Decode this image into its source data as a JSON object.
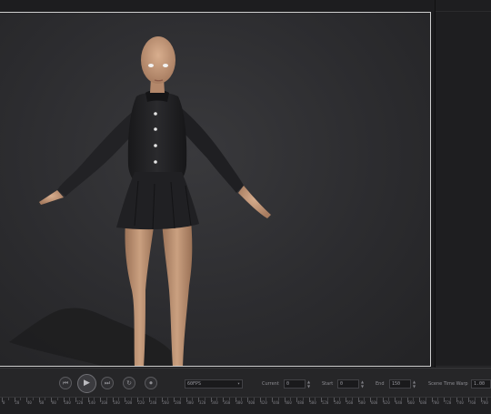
{
  "viewport": {
    "label": "3D viewport"
  },
  "transport": {
    "buttons": [
      {
        "name": "skip-to-start-button",
        "glyph": "⏮"
      },
      {
        "name": "play-button",
        "glyph": "▶"
      },
      {
        "name": "skip-to-end-button",
        "glyph": "⏭"
      },
      {
        "name": "loop-button",
        "glyph": "↻"
      },
      {
        "name": "record-button",
        "glyph": "⏺"
      }
    ],
    "fps_dropdown": "60FPS",
    "current_label": "Current",
    "current_value": "0",
    "start_label": "Start",
    "start_value": "0",
    "end_label": "End",
    "end_value": "150",
    "time_warp_label": "Scene Time Warp",
    "time_warp_value": "1.00",
    "spin_up": "▲",
    "spin_down": "▼",
    "dropdown_arrow": "▾"
  },
  "ruler": {
    "labels": [
      "0",
      "20",
      "40",
      "60",
      "80",
      "100",
      "120",
      "140",
      "160",
      "180",
      "200",
      "220",
      "240",
      "260",
      "280",
      "300",
      "320",
      "340",
      "360",
      "380",
      "400",
      "420",
      "440",
      "460",
      "480",
      "500",
      "520",
      "540",
      "560",
      "580",
      "600",
      "620",
      "640",
      "660",
      "680",
      "700",
      "720",
      "740",
      "760",
      "780"
    ]
  },
  "colors": {
    "background": "#1b1b1d",
    "viewport_border": "#cfcfcf",
    "skin": "#c49a7c",
    "dress": "#1c1c1e"
  }
}
